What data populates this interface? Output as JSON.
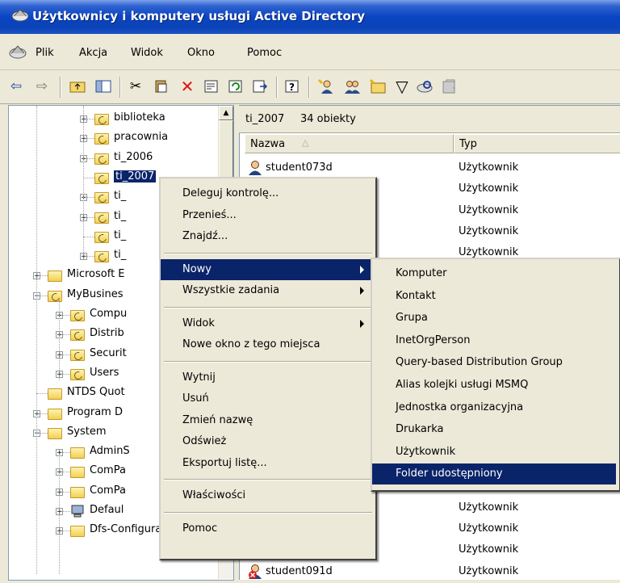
{
  "window": {
    "title": "Użytkownicy i komputery usługi Active Directory"
  },
  "menubar": [
    "Plik",
    "Akcja",
    "Widok",
    "Okno",
    "Pomoc"
  ],
  "toolbar": {
    "icons": [
      "back-arrow-icon",
      "forward-arrow-icon",
      "up-folder-icon",
      "show-hide-tree-icon",
      "cut-icon",
      "copy-icon",
      "delete-icon",
      "properties-icon",
      "refresh-icon",
      "export-list-icon",
      "help-icon",
      "new-user-icon",
      "new-group-icon",
      "new-ou-icon",
      "filter-icon",
      "find-icon",
      "add-to-group-icon"
    ]
  },
  "tree": {
    "nodes": [
      {
        "label": "biblioteka",
        "expand": "+",
        "type": "ou",
        "indent": 3
      },
      {
        "label": "pracownia",
        "expand": "+",
        "type": "ou",
        "indent": 3
      },
      {
        "label": "ti_2006",
        "expand": "+",
        "type": "ou",
        "indent": 3
      },
      {
        "label": "ti_2007",
        "expand": "",
        "type": "ou",
        "indent": 3,
        "selected": true
      },
      {
        "label": "ti_",
        "expand": "+",
        "type": "ou",
        "indent": 3
      },
      {
        "label": "ti_",
        "expand": "+",
        "type": "ou",
        "indent": 3
      },
      {
        "label": "ti_",
        "expand": "",
        "type": "ou",
        "indent": 3
      },
      {
        "label": "ti_",
        "expand": "+",
        "type": "ou",
        "indent": 3
      },
      {
        "label": "Microsoft E",
        "expand": "+",
        "type": "folder",
        "indent": 1
      },
      {
        "label": "MyBusines",
        "expand": "−",
        "type": "ou",
        "indent": 1
      },
      {
        "label": "Compu",
        "expand": "+",
        "type": "ou",
        "indent": 2
      },
      {
        "label": "Distrib",
        "expand": "+",
        "type": "ou",
        "indent": 2
      },
      {
        "label": "Securit",
        "expand": "+",
        "type": "ou",
        "indent": 2
      },
      {
        "label": "Users",
        "expand": "+",
        "type": "ou",
        "indent": 2
      },
      {
        "label": "NTDS Quot",
        "expand": "",
        "type": "folder",
        "indent": 1
      },
      {
        "label": "Program D",
        "expand": "+",
        "type": "folder",
        "indent": 1
      },
      {
        "label": "System",
        "expand": "−",
        "type": "folder",
        "indent": 1
      },
      {
        "label": "AdminS",
        "expand": "+",
        "type": "folder",
        "indent": 2
      },
      {
        "label": "ComPa",
        "expand": "+",
        "type": "folder",
        "indent": 2
      },
      {
        "label": "ComPa",
        "expand": "+",
        "type": "folder",
        "indent": 2
      },
      {
        "label": "Defaul",
        "expand": "+",
        "type": "computer",
        "indent": 2
      },
      {
        "label": "Dfs-Configuratic",
        "expand": "+",
        "type": "folder",
        "indent": 2
      }
    ]
  },
  "rightpane": {
    "container": "ti_2007",
    "count": "34 obiekty",
    "columns": [
      "Nazwa",
      "Typ"
    ],
    "rows": [
      {
        "name": "student073d",
        "type": "Użytkownik",
        "disabled": false
      },
      {
        "name": "",
        "type": "Użytkownik",
        "disabled": false
      },
      {
        "name": "",
        "type": "Użytkownik",
        "disabled": false
      },
      {
        "name": "",
        "type": "Użytkownik",
        "disabled": false
      },
      {
        "name": "",
        "type": "Użytkownik",
        "disabled": false
      },
      {
        "name": "",
        "type": "Użytkownik",
        "disabled": false
      },
      {
        "name": "",
        "type": "Użytkownik",
        "disabled": false
      },
      {
        "name": "",
        "type": "Użytkownik",
        "disabled": false
      },
      {
        "name": "",
        "type": "Użytkownik",
        "disabled": false
      },
      {
        "name": "",
        "type": "Użytkownik",
        "disabled": false
      },
      {
        "name": "",
        "type": "Użytkownik",
        "disabled": false
      },
      {
        "name": "",
        "type": "Użytkownik",
        "disabled": false
      },
      {
        "name": "",
        "type": "Użytkownik",
        "disabled": false
      },
      {
        "name": "",
        "type": "Użytkownik",
        "disabled": false
      },
      {
        "name": "",
        "type": "Użytkownik",
        "disabled": false
      },
      {
        "name": "",
        "type": "Użytkownik",
        "disabled": false
      },
      {
        "name": "",
        "type": "Użytkownik",
        "disabled": false
      },
      {
        "name": "",
        "type": "Użytkownik",
        "disabled": false
      },
      {
        "name": "",
        "type": "Użytkownik",
        "disabled": false
      },
      {
        "name": "student091d",
        "type": "Użytkownik",
        "disabled": true
      }
    ]
  },
  "context_menu": {
    "groups": [
      [
        "Deleguj kontrolę...",
        "Przenieś...",
        "Znajdź..."
      ],
      [
        "Nowy",
        "Wszystkie zadania"
      ],
      [
        "Widok",
        "Nowe okno z tego miejsca"
      ],
      [
        "Wytnij",
        "Usuń",
        "Zmień nazwę",
        "Odśwież",
        "Eksportuj listę..."
      ],
      [
        "Właściwości"
      ],
      [
        "Pomoc"
      ]
    ],
    "highlighted": "Nowy",
    "submenu_items": [
      "Nowy",
      "Wszystkie zadania",
      "Widok"
    ]
  },
  "submenu": {
    "items": [
      "Komputer",
      "Kontakt",
      "Grupa",
      "InetOrgPerson",
      "Query-based Distribution Group",
      "Alias kolejki usługi MSMQ",
      "Jednostka organizacyjna",
      "Drukarka",
      "Użytkownik",
      "Folder udostępniony"
    ],
    "highlighted": "Folder udostępniony"
  },
  "colors": {
    "highlight": "#0a246a",
    "titlebar": "#0a44c4",
    "face": "#ece9d8"
  }
}
